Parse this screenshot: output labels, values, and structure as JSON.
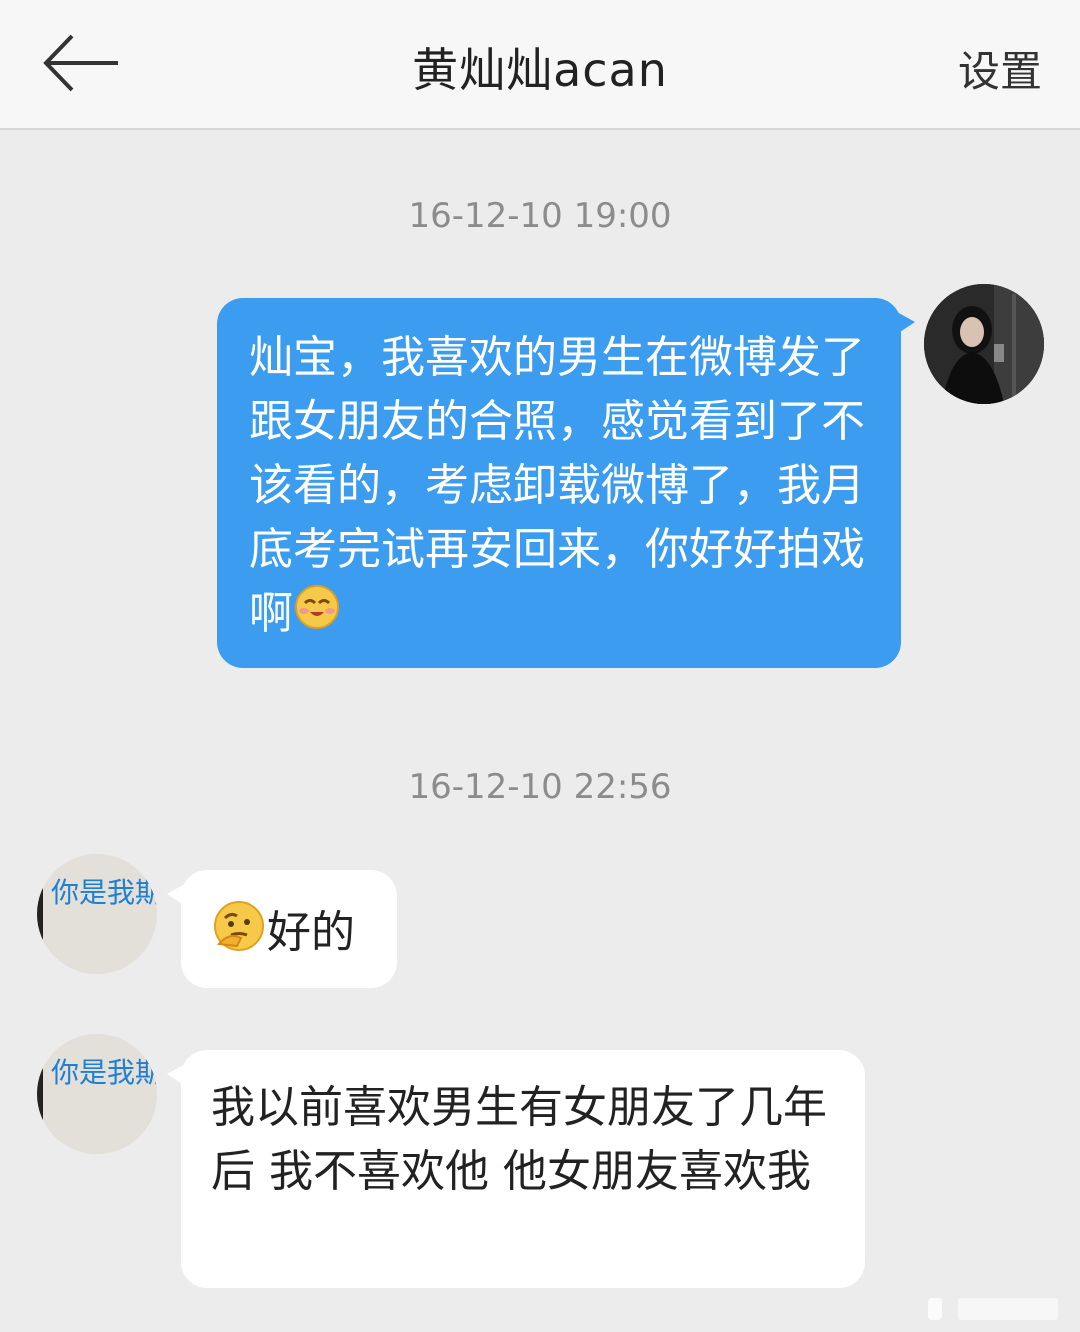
{
  "header": {
    "title": "黄灿灿acan",
    "settings_label": "设置"
  },
  "messages": [
    {
      "timestamp": "16-12-10 19:00"
    },
    {
      "direction": "outgoing",
      "text": "灿宝，我喜欢的男生在微博发了跟女朋友的合照，感觉看到了不该看的，考虑卸载微博了，我月底考完试再安回来，你好好拍戏啊",
      "emoji": "smile-emoji"
    },
    {
      "timestamp": "16-12-10 22:56"
    },
    {
      "direction": "incoming",
      "emoji": "thinking-emoji",
      "text": "好的"
    },
    {
      "direction": "incoming",
      "text": "我以前喜欢男生有女朋友了几年后 我不喜欢他 他女朋友喜欢我"
    }
  ],
  "colors": {
    "outgoing_bubble": "#3b9cf0",
    "incoming_bubble": "#ffffff",
    "background": "#ececec"
  },
  "avatars": {
    "contact_avatar_text": "你是我期待的夏"
  }
}
